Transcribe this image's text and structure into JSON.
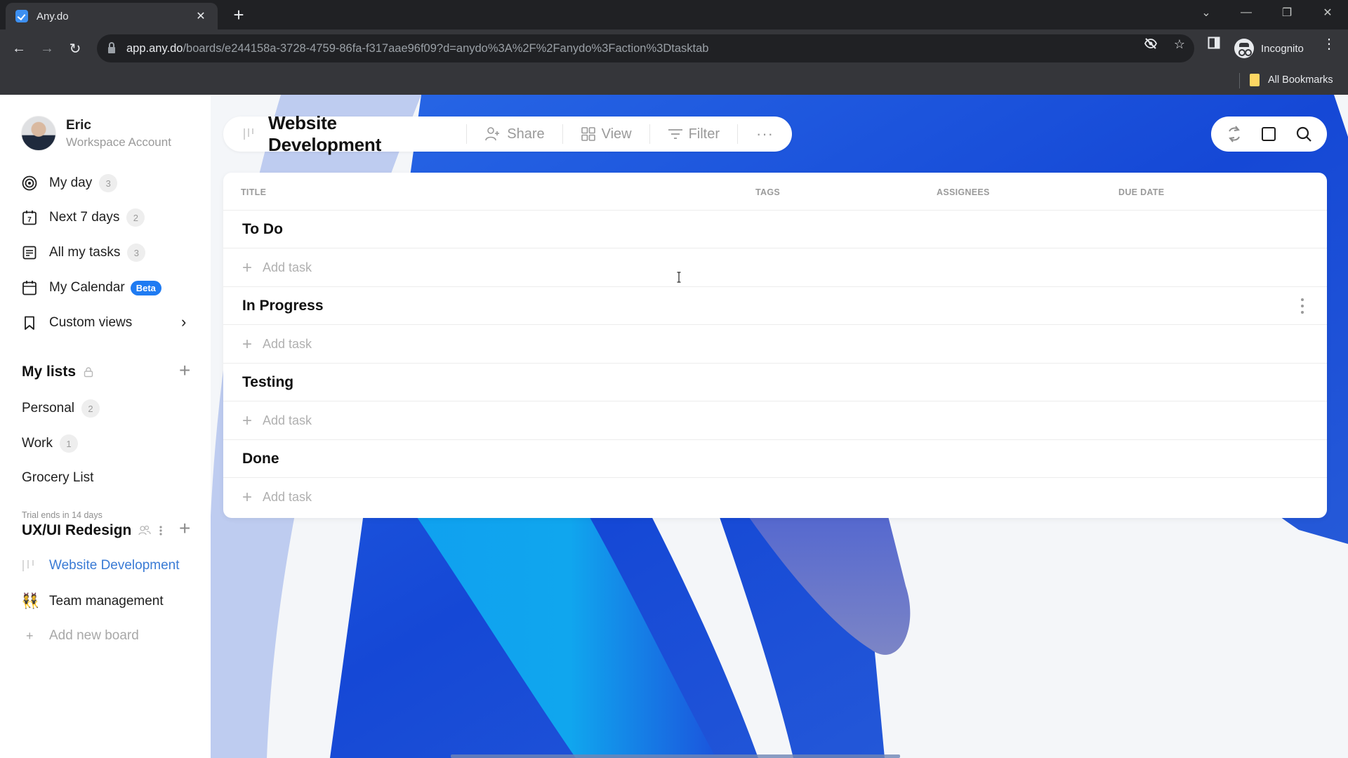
{
  "browser": {
    "tab_title": "Any.do",
    "url_host": "app.any.do",
    "url_path": "/boards/e244158a-3728-4759-86fa-f317aae96f09?d=anydo%3A%2F%2Fanydo%3Faction%3Dtasktab",
    "profile_label": "Incognito",
    "bookmarks_label": "All Bookmarks"
  },
  "user": {
    "name": "Eric",
    "account_type": "Workspace Account"
  },
  "sidebar": {
    "nav": [
      {
        "label": "My day",
        "count": "3",
        "icon": "target-icon"
      },
      {
        "label": "Next 7 days",
        "count": "2",
        "icon": "calendar-7-icon"
      },
      {
        "label": "All my tasks",
        "count": "3",
        "icon": "list-icon"
      },
      {
        "label": "My Calendar",
        "badge": "Beta",
        "icon": "calendar-icon"
      },
      {
        "label": "Custom views",
        "icon": "bookmark-icon"
      }
    ],
    "my_lists": {
      "title": "My lists",
      "items": [
        {
          "label": "Personal",
          "count": "2"
        },
        {
          "label": "Work",
          "count": "1"
        },
        {
          "label": "Grocery List"
        }
      ]
    },
    "workspace": {
      "trial_notice": "Trial ends in 14 days",
      "title": "UX/UI Redesign",
      "boards": [
        {
          "label": "Website Development",
          "active": true
        },
        {
          "label": "Team management",
          "emoji": "👯"
        }
      ],
      "add_board_label": "Add new board"
    }
  },
  "board": {
    "title": "Website Development",
    "actions": {
      "share": "Share",
      "view": "View",
      "filter": "Filter",
      "more": "···"
    },
    "columns": [
      "TITLE",
      "TAGS",
      "ASSIGNEES",
      "DUE DATE"
    ],
    "sections": [
      {
        "title": "To Do",
        "add_label": "Add task"
      },
      {
        "title": "In Progress",
        "add_label": "Add task"
      },
      {
        "title": "Testing",
        "add_label": "Add task"
      },
      {
        "title": "Done",
        "add_label": "Add task"
      }
    ]
  },
  "colors": {
    "accent": "#1f7bf2",
    "active_board": "#3a7bd5",
    "background_blue": "#1a5fe0"
  }
}
